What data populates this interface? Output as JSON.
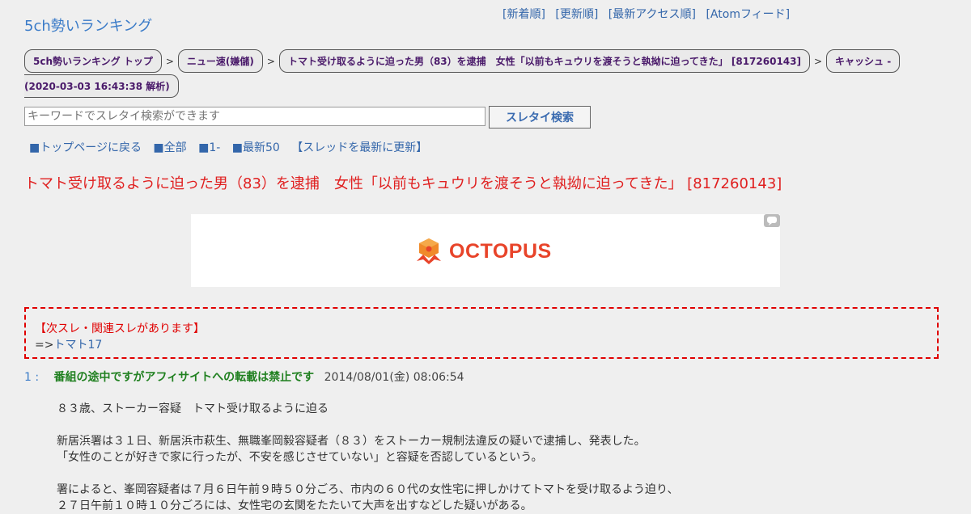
{
  "site": {
    "title": "5ch勢いランキング"
  },
  "topnav": [
    "[新着順]",
    "[更新順]",
    "[最新アクセス順]",
    "[Atomフィード]"
  ],
  "breadcrumbs": {
    "items": [
      "5ch勢いランキング トップ",
      "ニュー速(嫌儲)",
      "トマト受け取るように迫った男（83）を逮捕　女性「以前もキュウリを渡そうと執拗に迫ってきた」 [817260143]",
      "キャッシュ - "
    ],
    "separator": ">",
    "analyzed": "(2020-03-03 16:43:38 解析)"
  },
  "search": {
    "placeholder": "キーワードでスレタイ検索ができます",
    "button": "スレタイ検索"
  },
  "subnav": [
    "■トップページに戻る",
    "■全部",
    "■1-",
    "■最新50",
    "【スレッドを最新に更新】"
  ],
  "thread": {
    "title": "トマト受け取るように迫った男（83）を逮捕　女性「以前もキュウリを渡そうと執拗に迫ってきた」 [817260143]"
  },
  "ad": {
    "brand": "OCTOPUS",
    "badge_icon": "speech-bubble-icon"
  },
  "notice": {
    "title": "【次スレ・関連スレがあります】",
    "arrow": "=>",
    "link": "トマト17"
  },
  "post": {
    "number": "1 :",
    "name": "番組の途中ですがアフィサイトへの転載は禁止です",
    "date": "2014/08/01(金) 08:06:54",
    "lines": [
      "８３歳、ストーカー容疑　トマト受け取るように迫る",
      "新居浜署は３１日、新居浜市萩生、無職峯岡毅容疑者（８３）をストーカー規制法違反の疑いで逮捕し、発表した。",
      "「女性のことが好きで家に行ったが、不安を感じさせていない」と容疑を否認しているという。",
      "署によると、峯岡容疑者は７月６日午前９時５０分ごろ、市内の６０代の女性宅に押しかけてトマトを受け取るよう迫り、",
      "２７日午前１０時１０分ごろには、女性宅の玄関をたたいて大声を出すなどした疑いがある。"
    ]
  },
  "colors": {
    "background": "#efefef",
    "link": "#3a7bc8",
    "title_red": "#e02020",
    "name_green": "#208020",
    "crumb_text": "#4a1a6a",
    "ad_brand": "#e8442a"
  }
}
